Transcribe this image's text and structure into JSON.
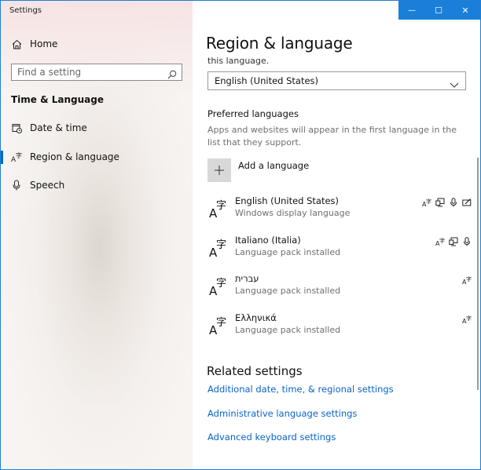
{
  "app": {
    "title": "Settings"
  },
  "window_controls": {
    "minimize_glyph": "—",
    "maximize_glyph": "☐",
    "close_glyph": "✕"
  },
  "sidebar": {
    "home_label": "Home",
    "search_placeholder": "Find a setting",
    "section_title": "Time & Language",
    "items": [
      {
        "label": "Date & time",
        "icon": "calendar-clock-icon",
        "active": false
      },
      {
        "label": "Region & language",
        "icon": "language-icon",
        "active": true
      },
      {
        "label": "Speech",
        "icon": "microphone-icon",
        "active": false
      }
    ]
  },
  "main": {
    "title": "Region & language",
    "cut_text": "this language.",
    "country_dropdown": {
      "value": "English (United States)"
    },
    "preferred_title": "Preferred languages",
    "preferred_desc": "Apps and websites will appear in the first language in the list that they support.",
    "add_language_label": "Add a language",
    "languages": [
      {
        "name": "English (United States)",
        "sub": "Windows display language",
        "features": [
          "language-pack-icon",
          "display-icon",
          "microphone-icon",
          "handwriting-icon"
        ]
      },
      {
        "name": "Italiano (Italia)",
        "sub": "Language pack installed",
        "features": [
          "language-pack-icon",
          "display-icon",
          "microphone-icon"
        ]
      },
      {
        "name": "עברית",
        "sub": "Language pack installed",
        "features": [
          "language-pack-icon"
        ]
      },
      {
        "name": "Ελληνικά",
        "sub": "Language pack installed",
        "features": [
          "language-pack-icon"
        ]
      }
    ],
    "related_title": "Related settings",
    "links": [
      "Additional date, time, & regional settings",
      "Administrative language settings",
      "Advanced keyboard settings"
    ]
  },
  "colors": {
    "accent": "#0066cc",
    "titlebar": "#1a7fd8",
    "link": "#0a64c8"
  }
}
